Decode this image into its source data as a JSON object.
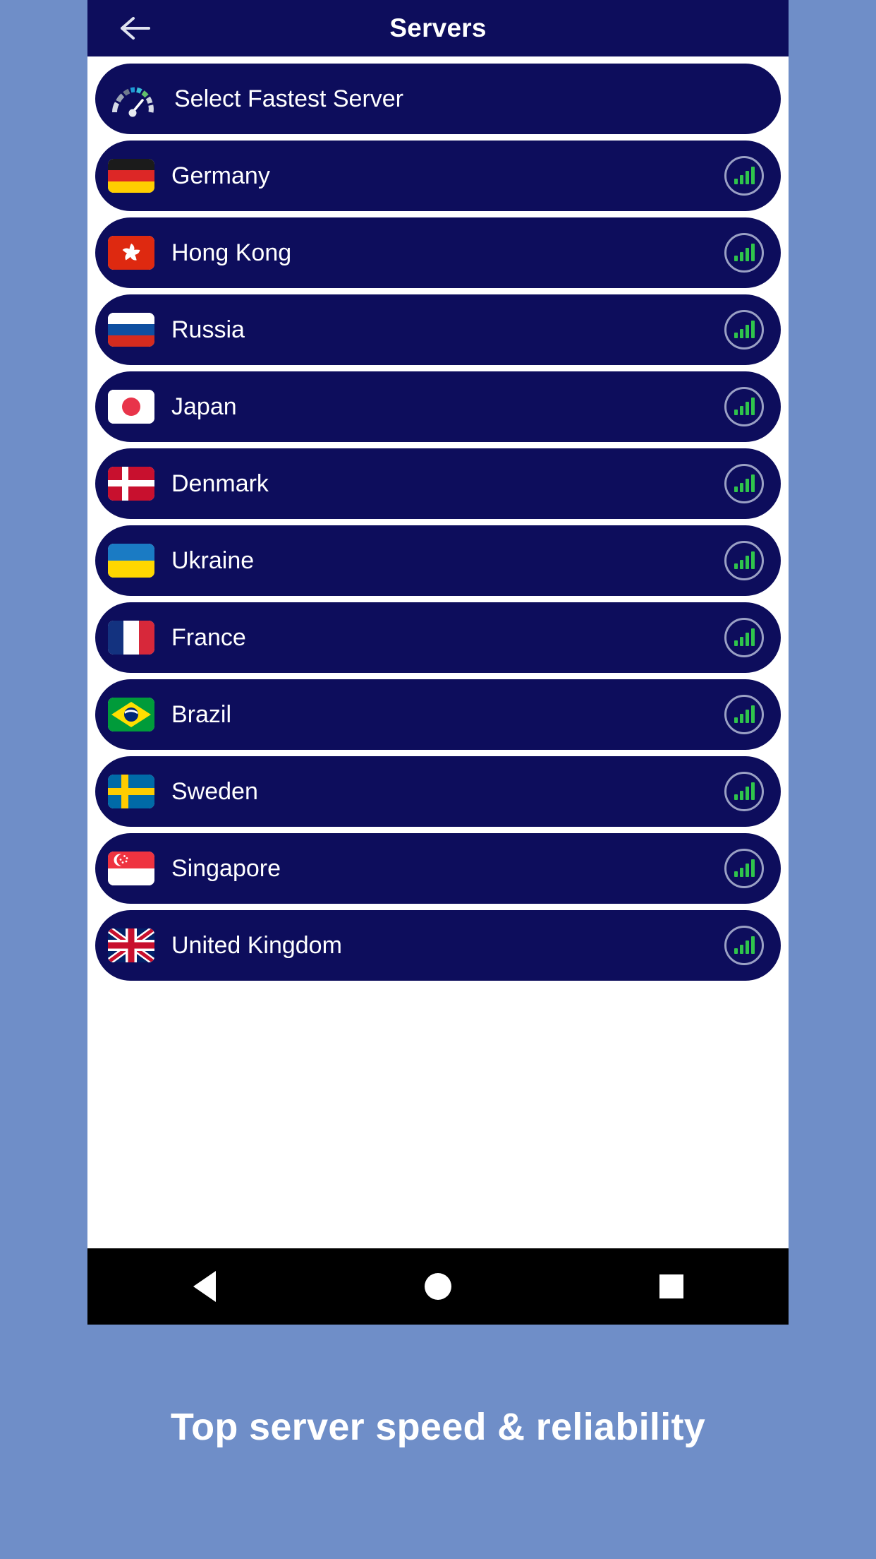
{
  "appbar": {
    "title": "Servers",
    "back_icon": "arrow-left-icon"
  },
  "list": {
    "fastest": {
      "label": "Select Fastest Server",
      "icon": "speed-gauge-icon"
    },
    "signal_icon": "signal-strength-icon",
    "servers": [
      {
        "name": "Germany",
        "flag": "de"
      },
      {
        "name": "Hong Kong",
        "flag": "hk"
      },
      {
        "name": "Russia",
        "flag": "ru"
      },
      {
        "name": "Japan",
        "flag": "jp"
      },
      {
        "name": "Denmark",
        "flag": "dk"
      },
      {
        "name": "Ukraine",
        "flag": "ua"
      },
      {
        "name": "France",
        "flag": "fr"
      },
      {
        "name": "Brazil",
        "flag": "br"
      },
      {
        "name": "Sweden",
        "flag": "se"
      },
      {
        "name": "Singapore",
        "flag": "sg"
      },
      {
        "name": "United Kingdom",
        "flag": "gb"
      }
    ]
  },
  "navbar": {
    "back": "back-triangle-icon",
    "home": "home-circle-icon",
    "recents": "recents-square-icon"
  },
  "tagline": "Top server speed & reliability",
  "colors": {
    "background": "#6f8ec8",
    "card": "#0d0d5c",
    "surface": "#ffffff",
    "signal_green": "#2fc44c",
    "navbar": "#000000"
  }
}
